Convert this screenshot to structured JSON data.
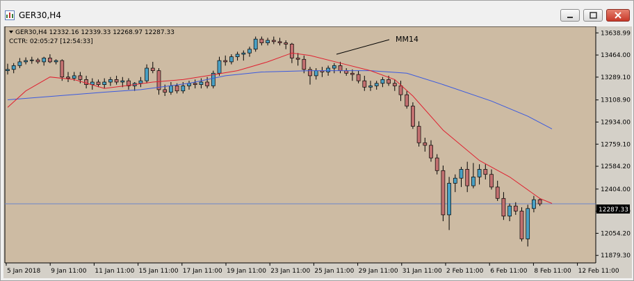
{
  "window": {
    "title": "GER30,H4"
  },
  "chart": {
    "symbol_line": "GER30,H4  12332.16 12339.33 12268.97 12287.33",
    "cctr_line": "CCTR: 02:05:27 [12:54:33]",
    "annotation": "MM14",
    "current_price": "12287.33",
    "price_ticks": [
      "13638.99",
      "13464.00",
      "13289.10",
      "13108.90",
      "12934.00",
      "12759.10",
      "12584.20",
      "12404.00",
      "12229.10",
      "12054.20",
      "11879.30"
    ],
    "date_ticks": [
      "5 Jan 2018",
      "9 Jan 11:00",
      "11 Jan 11:00",
      "15 Jan 11:00",
      "17 Jan 11:00",
      "19 Jan 11:00",
      "23 Jan 11:00",
      "25 Jan 11:00",
      "29 Jan 11:00",
      "31 Jan 11:00",
      "2 Feb 11:00",
      "6 Feb 11:00",
      "8 Feb 11:00",
      "12 Feb 11:00"
    ],
    "colors": {
      "background": "#cdbba3",
      "bull": "#4aa0c4",
      "bear": "#c27070",
      "wick": "#000000",
      "ma_fast": "#e02030",
      "ma_slow": "#3a5ae0",
      "price_line": "#6a86c8"
    }
  },
  "chart_data": {
    "type": "candlestick",
    "ylim": [
      11820,
      13690
    ],
    "candles": [
      [
        13340,
        13395,
        13310,
        13350
      ],
      [
        13350,
        13400,
        13320,
        13380
      ],
      [
        13380,
        13440,
        13360,
        13410
      ],
      [
        13410,
        13445,
        13390,
        13420
      ],
      [
        13420,
        13450,
        13395,
        13425
      ],
      [
        13425,
        13440,
        13395,
        13410
      ],
      [
        13410,
        13450,
        13380,
        13440
      ],
      [
        13440,
        13470,
        13400,
        13410
      ],
      [
        13410,
        13430,
        13390,
        13420
      ],
      [
        13420,
        13430,
        13260,
        13290
      ],
      [
        13290,
        13330,
        13250,
        13280
      ],
      [
        13280,
        13330,
        13260,
        13300
      ],
      [
        13300,
        13330,
        13240,
        13270
      ],
      [
        13270,
        13300,
        13200,
        13230
      ],
      [
        13230,
        13280,
        13190,
        13250
      ],
      [
        13250,
        13270,
        13210,
        13230
      ],
      [
        13230,
        13280,
        13200,
        13250
      ],
      [
        13250,
        13290,
        13220,
        13270
      ],
      [
        13270,
        13300,
        13230,
        13250
      ],
      [
        13250,
        13290,
        13210,
        13260
      ],
      [
        13260,
        13280,
        13190,
        13220
      ],
      [
        13220,
        13250,
        13180,
        13240
      ],
      [
        13240,
        13290,
        13210,
        13260
      ],
      [
        13260,
        13390,
        13240,
        13360
      ],
      [
        13360,
        13410,
        13320,
        13340
      ],
      [
        13340,
        13360,
        13150,
        13190
      ],
      [
        13190,
        13230,
        13140,
        13170
      ],
      [
        13170,
        13250,
        13150,
        13220
      ],
      [
        13220,
        13240,
        13160,
        13180
      ],
      [
        13180,
        13250,
        13160,
        13220
      ],
      [
        13220,
        13260,
        13190,
        13240
      ],
      [
        13240,
        13270,
        13200,
        13230
      ],
      [
        13230,
        13280,
        13200,
        13250
      ],
      [
        13250,
        13290,
        13200,
        13220
      ],
      [
        13220,
        13340,
        13200,
        13320
      ],
      [
        13320,
        13450,
        13300,
        13420
      ],
      [
        13420,
        13460,
        13380,
        13410
      ],
      [
        13410,
        13470,
        13390,
        13450
      ],
      [
        13450,
        13490,
        13420,
        13470
      ],
      [
        13470,
        13500,
        13420,
        13480
      ],
      [
        13480,
        13530,
        13450,
        13510
      ],
      [
        13510,
        13610,
        13490,
        13590
      ],
      [
        13590,
        13610,
        13540,
        13560
      ],
      [
        13560,
        13600,
        13540,
        13580
      ],
      [
        13580,
        13610,
        13550,
        13570
      ],
      [
        13570,
        13600,
        13540,
        13560
      ],
      [
        13560,
        13580,
        13510,
        13550
      ],
      [
        13550,
        13560,
        13400,
        13440
      ],
      [
        13440,
        13480,
        13380,
        13430
      ],
      [
        13430,
        13460,
        13320,
        13350
      ],
      [
        13350,
        13370,
        13230,
        13300
      ],
      [
        13300,
        13360,
        13270,
        13340
      ],
      [
        13340,
        13370,
        13290,
        13330
      ],
      [
        13330,
        13380,
        13300,
        13360
      ],
      [
        13360,
        13400,
        13320,
        13380
      ],
      [
        13380,
        13410,
        13320,
        13340
      ],
      [
        13340,
        13360,
        13300,
        13320
      ],
      [
        13320,
        13350,
        13260,
        13310
      ],
      [
        13310,
        13340,
        13240,
        13260
      ],
      [
        13260,
        13300,
        13180,
        13210
      ],
      [
        13210,
        13260,
        13180,
        13220
      ],
      [
        13220,
        13260,
        13190,
        13240
      ],
      [
        13240,
        13290,
        13210,
        13270
      ],
      [
        13270,
        13300,
        13220,
        13240
      ],
      [
        13240,
        13270,
        13180,
        13220
      ],
      [
        13220,
        13260,
        13100,
        13150
      ],
      [
        13150,
        13180,
        13040,
        13060
      ],
      [
        13060,
        13090,
        12880,
        12900
      ],
      [
        12900,
        12940,
        12740,
        12770
      ],
      [
        12770,
        12810,
        12700,
        12750
      ],
      [
        12750,
        12790,
        12620,
        12650
      ],
      [
        12650,
        12680,
        12520,
        12550
      ],
      [
        12550,
        12590,
        12150,
        12200
      ],
      [
        12200,
        12500,
        12080,
        12450
      ],
      [
        12450,
        12520,
        12380,
        12490
      ],
      [
        12490,
        12580,
        12420,
        12560
      ],
      [
        12560,
        12620,
        12380,
        12430
      ],
      [
        12430,
        12610,
        12410,
        12500
      ],
      [
        12500,
        12600,
        12440,
        12560
      ],
      [
        12560,
        12600,
        12480,
        12520
      ],
      [
        12520,
        12560,
        12400,
        12420
      ],
      [
        12420,
        12470,
        12310,
        12330
      ],
      [
        12330,
        12380,
        12160,
        12190
      ],
      [
        12190,
        12290,
        12150,
        12270
      ],
      [
        12270,
        12300,
        12200,
        12230
      ],
      [
        12230,
        12260,
        11990,
        12010
      ],
      [
        12010,
        12280,
        11950,
        12250
      ],
      [
        12250,
        12350,
        12220,
        12320
      ],
      [
        12320,
        12330,
        12270,
        12287
      ]
    ],
    "ma_fast": [
      [
        0,
        13050
      ],
      [
        3,
        13180
      ],
      [
        7,
        13290
      ],
      [
        11,
        13270
      ],
      [
        16,
        13200
      ],
      [
        21,
        13230
      ],
      [
        24,
        13250
      ],
      [
        29,
        13270
      ],
      [
        33,
        13300
      ],
      [
        38,
        13340
      ],
      [
        43,
        13410
      ],
      [
        47,
        13480
      ],
      [
        50,
        13460
      ],
      [
        55,
        13400
      ],
      [
        60,
        13340
      ],
      [
        64,
        13270
      ],
      [
        67,
        13140
      ],
      [
        72,
        12870
      ],
      [
        78,
        12630
      ],
      [
        83,
        12500
      ],
      [
        88,
        12330
      ],
      [
        90,
        12290
      ]
    ],
    "ma_slow": [
      [
        0,
        13110
      ],
      [
        8,
        13140
      ],
      [
        16,
        13170
      ],
      [
        22,
        13190
      ],
      [
        30,
        13240
      ],
      [
        36,
        13300
      ],
      [
        42,
        13330
      ],
      [
        50,
        13340
      ],
      [
        60,
        13340
      ],
      [
        66,
        13320
      ],
      [
        72,
        13230
      ],
      [
        80,
        13100
      ],
      [
        86,
        12980
      ],
      [
        90,
        12880
      ]
    ]
  }
}
